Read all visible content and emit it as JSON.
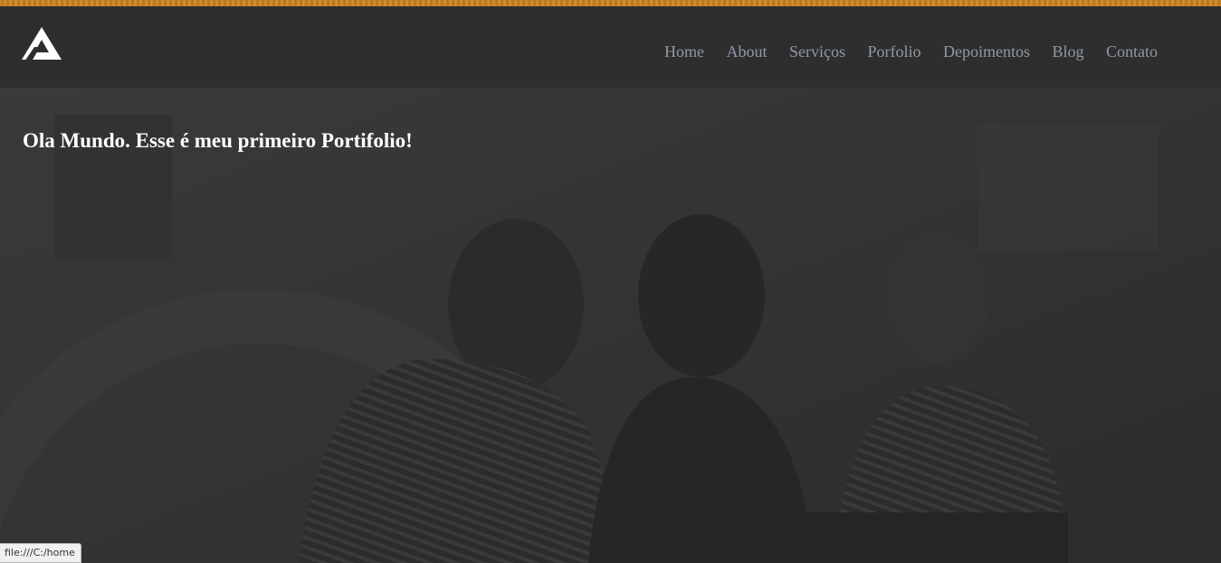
{
  "header": {
    "logo_icon": "triangle-a-logo-icon",
    "nav": [
      {
        "id": "home",
        "label": "Home"
      },
      {
        "id": "about",
        "label": "About"
      },
      {
        "id": "servicos",
        "label": "Serviços"
      },
      {
        "id": "porfolio",
        "label": "Porfolio"
      },
      {
        "id": "depoimentos",
        "label": "Depoimentos"
      },
      {
        "id": "blog",
        "label": "Blog"
      },
      {
        "id": "contato",
        "label": "Contato"
      }
    ]
  },
  "hero": {
    "title": "Ola Mundo. Esse é meu primeiro Portifolio!",
    "background_image": "dark-photo-people-looking-at-laptop"
  },
  "status_bar": {
    "url": "file:///C:/home"
  },
  "colors": {
    "top_strip": "#c98a2a",
    "header_bg": "#2e2e2e",
    "nav_text": "#8e9aa6",
    "hero_title": "#ffffff"
  }
}
